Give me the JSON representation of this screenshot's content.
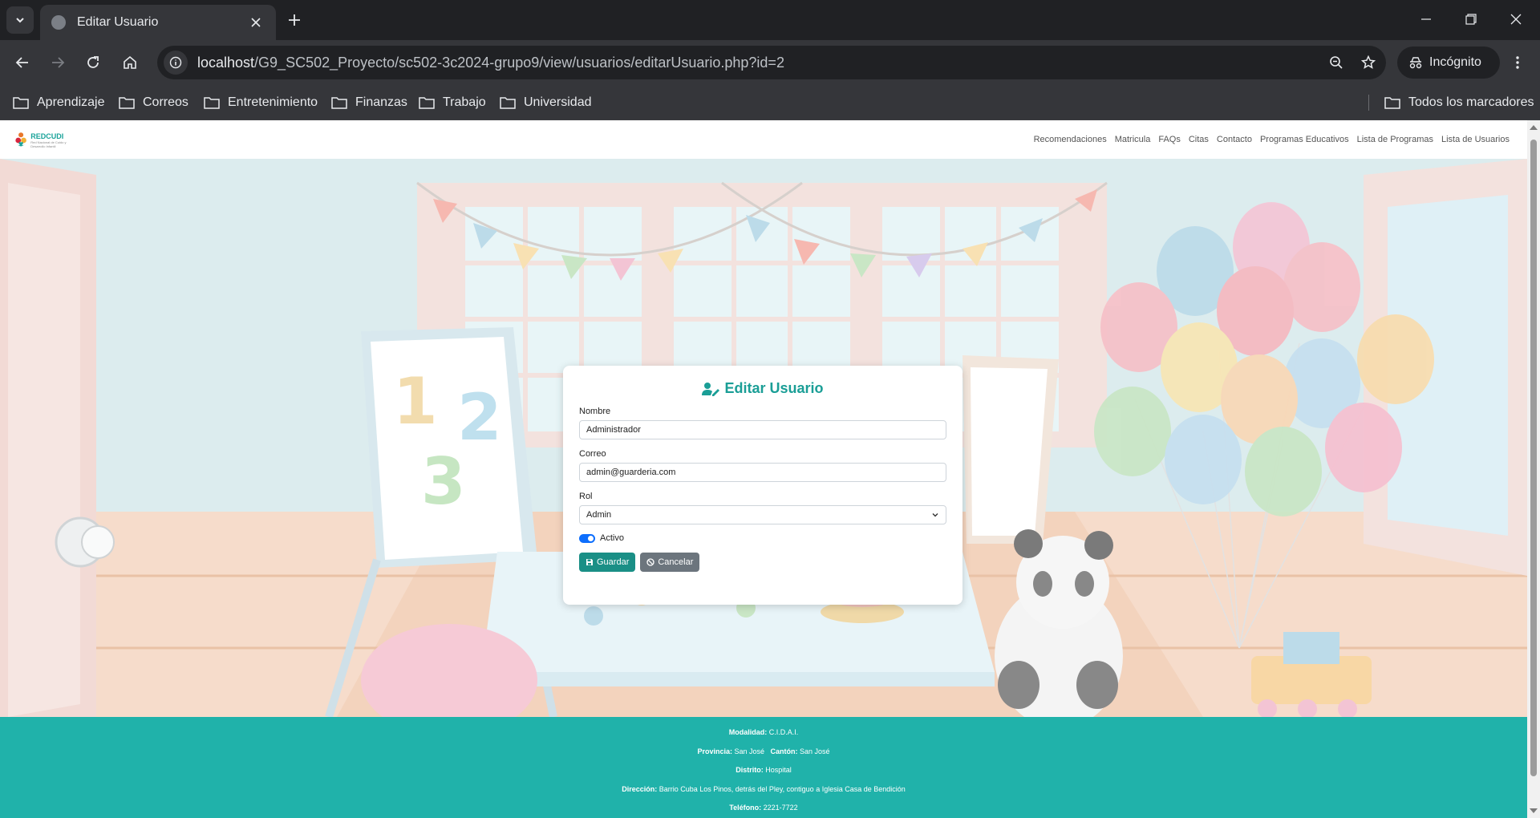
{
  "browser": {
    "tab_title": "Editar Usuario",
    "url_host": "localhost",
    "url_path": "/G9_SC502_Proyecto/sc502-3c2024-grupo9/view/usuarios/editarUsuario.php?id=2",
    "incognito_label": "Incógnito",
    "bookmarks": [
      "Aprendizaje",
      "Correos",
      "Entretenimiento",
      "Finanzas",
      "Trabajo",
      "Universidad"
    ],
    "all_bookmarks_label": "Todos los marcadores"
  },
  "site": {
    "logo_text": "REDCUDI",
    "logo_subtext": "Red Nacional de Cuido y Desarrollo Infantil",
    "nav": [
      "Recomendaciones",
      "Matricula",
      "FAQs",
      "Citas",
      "Contacto",
      "Programas Educativos",
      "Lista de Programas",
      "Lista de Usuarios"
    ]
  },
  "form": {
    "title": "Editar Usuario",
    "nombre_label": "Nombre",
    "nombre_value": "Administrador",
    "correo_label": "Correo",
    "correo_value": "admin@guarderia.com",
    "rol_label": "Rol",
    "rol_value": "Admin",
    "activo_label": "Activo",
    "activo_checked": true,
    "save_label": "Guardar",
    "cancel_label": "Cancelar"
  },
  "footer": {
    "modalidad_label": "Modalidad:",
    "modalidad_value": "C.I.D.A.I.",
    "provincia_label": "Provincia:",
    "provincia_value": "San José",
    "canton_label": "Cantón:",
    "canton_value": "San José",
    "distrito_label": "Distrito:",
    "distrito_value": "Hospital",
    "direccion_label": "Dirección:",
    "direccion_value": "Barrio Cuba Los Pinos, detrás del Pley, contiguo a Iglesia Casa de Bendición",
    "telefono_label": "Teléfono:",
    "telefono_value": "2221-7722"
  },
  "colors": {
    "accent": "#1a9e96",
    "footer_bg": "#20b2aa",
    "switch_on": "#0d6efd",
    "cancel_btn": "#6c757d"
  }
}
